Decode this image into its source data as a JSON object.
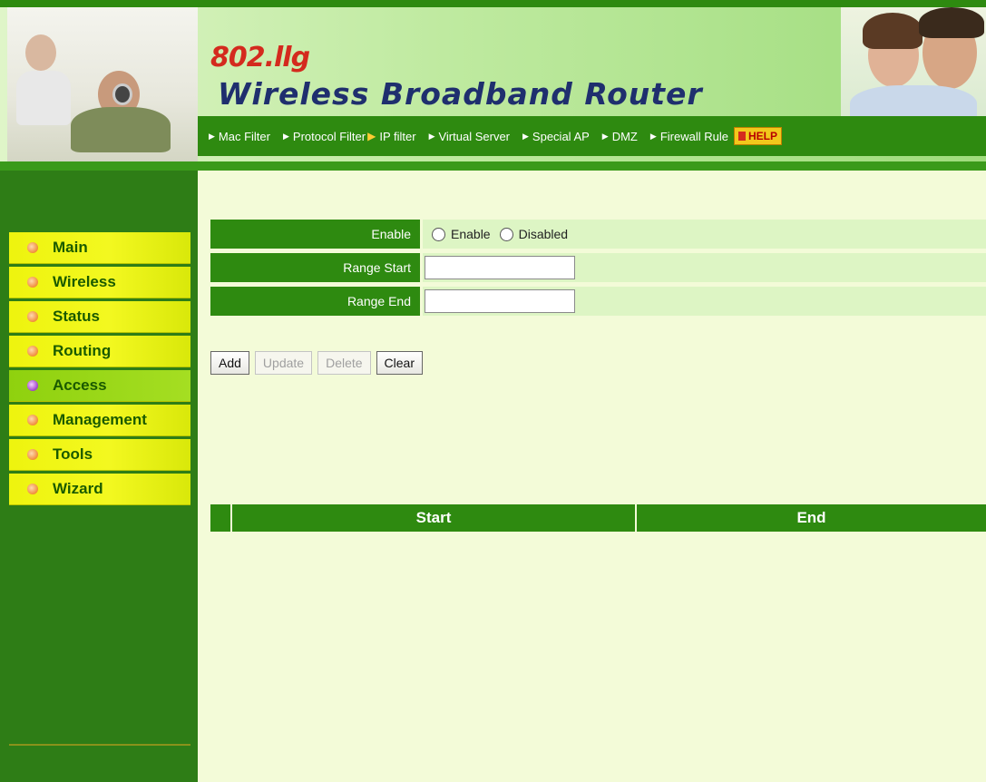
{
  "header": {
    "model": "802.llg",
    "title": "Wireless Broadband Router"
  },
  "nav": {
    "items": [
      {
        "label": "Mac Filter",
        "active": false
      },
      {
        "label": "Protocol Filter",
        "active": false
      },
      {
        "label": "IP filter",
        "active": true
      },
      {
        "label": "Virtual Server",
        "active": false
      },
      {
        "label": "Special AP",
        "active": false
      },
      {
        "label": "DMZ",
        "active": false
      },
      {
        "label": "Firewall Rule",
        "active": false
      }
    ],
    "help_label": "HELP"
  },
  "sidebar": {
    "items": [
      {
        "label": "Main",
        "active": false
      },
      {
        "label": "Wireless",
        "active": false
      },
      {
        "label": "Status",
        "active": false
      },
      {
        "label": "Routing",
        "active": false
      },
      {
        "label": "Access",
        "active": true
      },
      {
        "label": "Management",
        "active": false
      },
      {
        "label": "Tools",
        "active": false
      },
      {
        "label": "Wizard",
        "active": false
      }
    ]
  },
  "form": {
    "enable_label": "Enable",
    "enable_option": "Enable",
    "disabled_option": "Disabled",
    "range_start_label": "Range Start",
    "range_start_value": "",
    "range_end_label": "Range End",
    "range_end_value": ""
  },
  "buttons": {
    "add": "Add",
    "update": "Update",
    "delete": "Delete",
    "clear": "Clear"
  },
  "table": {
    "columns": [
      "",
      "Start",
      "End"
    ]
  },
  "colors": {
    "brand_green": "#2e8a10",
    "menu_yellow": "#eef40e",
    "content_bg": "#f3fbd8"
  }
}
